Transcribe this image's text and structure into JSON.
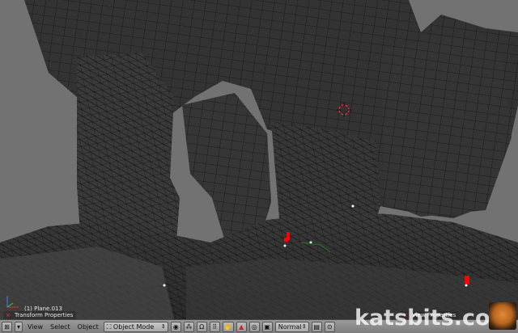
{
  "viewport": {
    "object_info": "(1) Plane.013",
    "panels": {
      "transform_label": "Transform Properties",
      "view_label": "View Properties"
    }
  },
  "header": {
    "menus": [
      "View",
      "Select",
      "Object"
    ],
    "mode": "Object Mode",
    "shading_mode": "Normal"
  },
  "watermark": "katsbits.com",
  "icons": [
    "window-type-icon",
    "3d-cursor-icon",
    "solid-shading-icon",
    "pivot-icon",
    "hand-icon",
    "move-manipulator-icon",
    "rotate-manipulator-icon",
    "scale-manipulator-icon",
    "layer-icon",
    "render-icon",
    "tiger-logo-icon"
  ],
  "colors": {
    "background": "#727272",
    "mesh": "#333333",
    "wire": "#141414",
    "selected": "#ff0000"
  }
}
